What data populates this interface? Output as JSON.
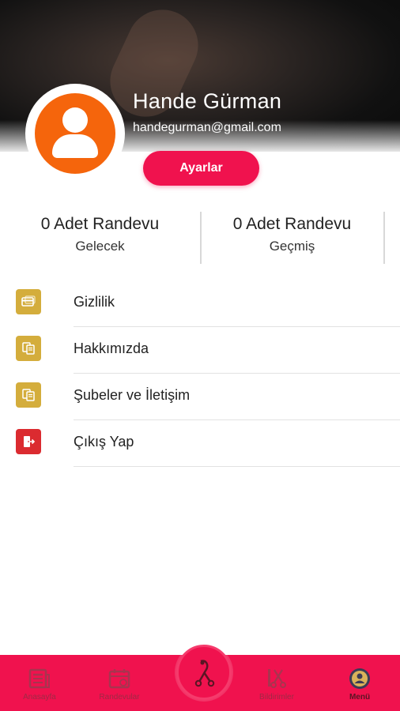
{
  "profile": {
    "name": "Hande Gürman",
    "email": "handegurman@gmail.com",
    "settings_label": "Ayarlar"
  },
  "stats": [
    {
      "count": "0 Adet Randevu",
      "label": "Gelecek"
    },
    {
      "count": "0 Adet Randevu",
      "label": "Geçmiş"
    }
  ],
  "menu": {
    "items": [
      {
        "label": "Gizlilik",
        "icon": "card-icon",
        "color": "#d4ad3c"
      },
      {
        "label": "Hakkımızda",
        "icon": "document-icon",
        "color": "#d4ad3c"
      },
      {
        "label": "Şubeler ve İletişim",
        "icon": "document-icon",
        "color": "#d4ad3c"
      },
      {
        "label": "Çıkış Yap",
        "icon": "exit-icon",
        "color": "#db2b30"
      }
    ]
  },
  "bottom_nav": {
    "items": [
      {
        "label": "Anasayfa",
        "icon": "home-news-icon"
      },
      {
        "label": "Randevular",
        "icon": "calendar-icon"
      },
      {
        "label": "",
        "icon": "scissors-logo-icon"
      },
      {
        "label": "Bildirimler",
        "icon": "notification-scissors-icon"
      },
      {
        "label": "Menü",
        "icon": "menu-user-icon",
        "active": true
      }
    ]
  },
  "colors": {
    "accent": "#f0124e",
    "avatar": "#f5650c",
    "menu_icon_gold": "#d4ad3c",
    "menu_icon_red": "#db2b30"
  }
}
